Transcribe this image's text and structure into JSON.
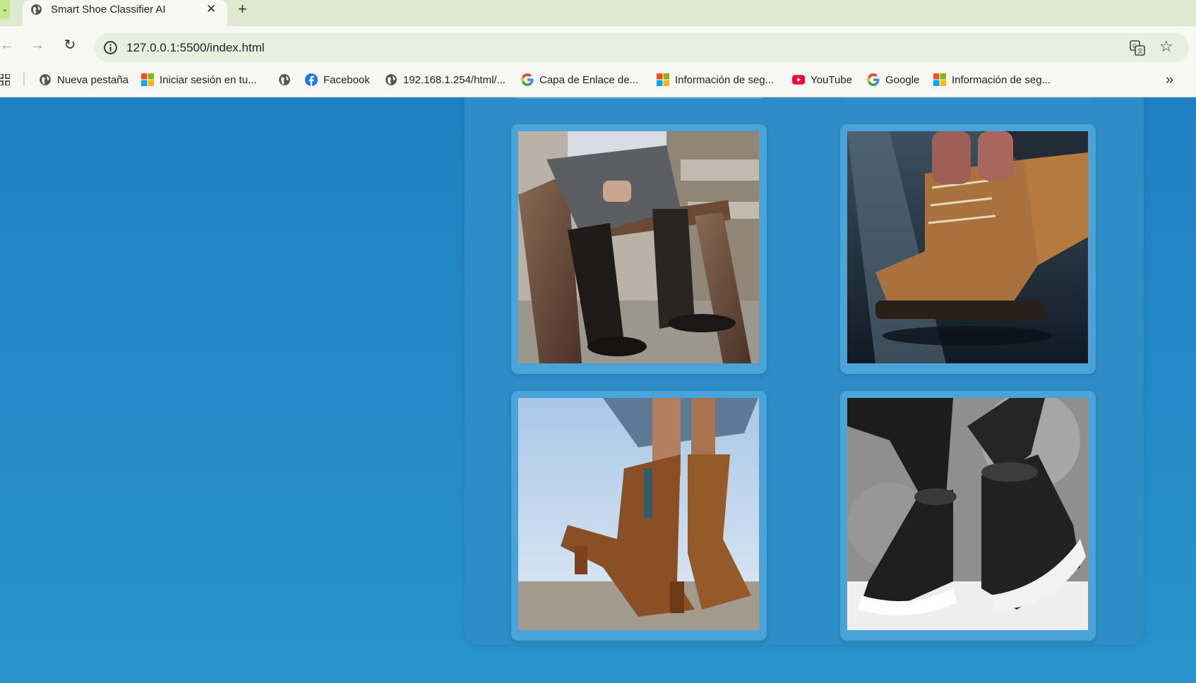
{
  "browser": {
    "tab": {
      "title": "Smart Shoe Classifier AI",
      "close_glyph": "✕",
      "favicon": "globe-icon"
    },
    "new_tab_glyph": "+",
    "url": "127.0.0.1:5500/index.html",
    "bookmarks": [
      {
        "label": "Nueva pestaña",
        "icon": "globe-icon"
      },
      {
        "label": "Iniciar sesión en tu...",
        "icon": "microsoft-icon"
      },
      {
        "label": "",
        "icon": "globe-icon"
      },
      {
        "label": "Facebook",
        "icon": "facebook-icon"
      },
      {
        "label": "192.168.1.254/html/...",
        "icon": "globe-icon"
      },
      {
        "label": "Capa de Enlace de...",
        "icon": "google-icon"
      },
      {
        "label": "Información de seg...",
        "icon": "microsoft-icon"
      },
      {
        "label": "YouTube",
        "icon": "youtube-icon"
      },
      {
        "label": "Google",
        "icon": "google-icon"
      },
      {
        "label": "Información de seg...",
        "icon": "microsoft-icon"
      }
    ]
  },
  "gallery": {
    "images": [
      {
        "subject": "black leather riding boots"
      },
      {
        "subject": "tan lace-up work boot"
      },
      {
        "subject": "brown fringe suede cowboy boots"
      },
      {
        "subject": "black snow boots with white sole"
      }
    ]
  },
  "colors": {
    "page_bg": "#2389c6",
    "panel_bg": "#2e8dc7",
    "card_bg": "#4aa3d9"
  }
}
